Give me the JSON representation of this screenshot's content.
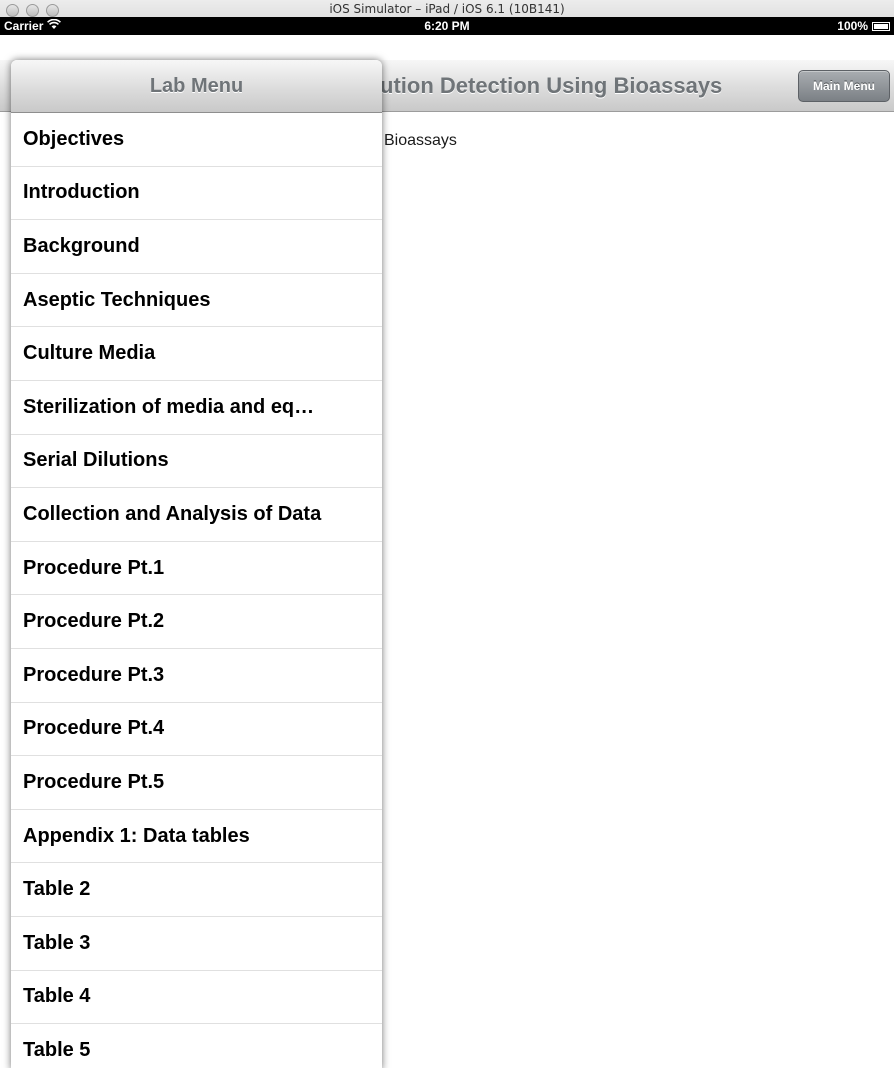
{
  "window": {
    "title": "iOS Simulator – iPad / iOS 6.1 (10B141)"
  },
  "statusbar": {
    "carrier": "Carrier",
    "time": "6:20 PM",
    "battery": "100%"
  },
  "navbar": {
    "title": "ution Detection Using Bioassays",
    "main_menu_label": "Main Menu"
  },
  "content": {
    "text": "Bioassays"
  },
  "popover": {
    "title": "Lab Menu",
    "items": [
      {
        "label": "Objectives"
      },
      {
        "label": "Introduction"
      },
      {
        "label": "Background"
      },
      {
        "label": "Aseptic Techniques"
      },
      {
        "label": "Culture Media"
      },
      {
        "label": "Sterilization of media and eq…"
      },
      {
        "label": "Serial Dilutions"
      },
      {
        "label": "Collection and Analysis of Data"
      },
      {
        "label": "Procedure Pt.1"
      },
      {
        "label": "Procedure Pt.2"
      },
      {
        "label": "Procedure Pt.3"
      },
      {
        "label": "Procedure Pt.4"
      },
      {
        "label": "Procedure Pt.5"
      },
      {
        "label": "Appendix 1: Data tables"
      },
      {
        "label": "Table 2"
      },
      {
        "label": "Table 3"
      },
      {
        "label": "Table 4"
      },
      {
        "label": "Table 5"
      }
    ]
  }
}
